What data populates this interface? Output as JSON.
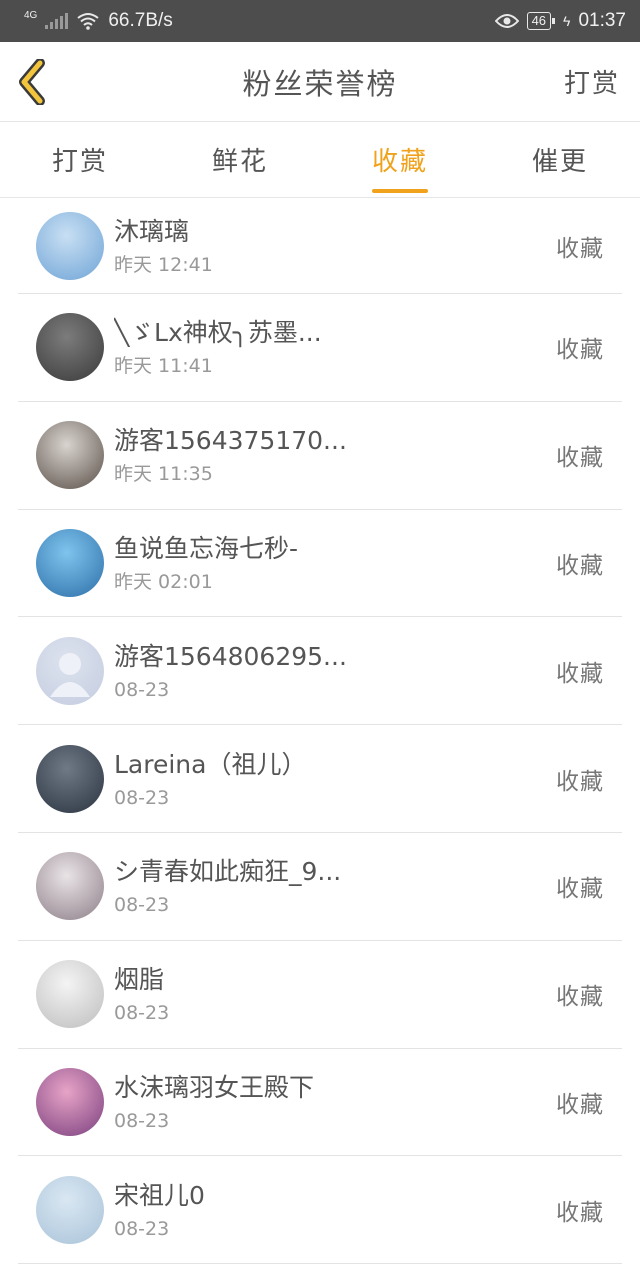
{
  "status_bar": {
    "network_type": "4G",
    "speed": "66.7B/s",
    "battery": "46",
    "time": "01:37"
  },
  "header": {
    "back_icon": "chevron-left-icon",
    "title": "粉丝荣誉榜",
    "action_label": "打赏"
  },
  "tabs": [
    {
      "label": "打赏",
      "active": false
    },
    {
      "label": "鲜花",
      "active": false
    },
    {
      "label": "收藏",
      "active": true
    },
    {
      "label": "催更",
      "active": false
    }
  ],
  "colors": {
    "accent": "#f0a21c",
    "status_bar": "#4d4d4d"
  },
  "fans": [
    {
      "name": "沐璃璃",
      "time": "昨天 12:41",
      "action": "收藏",
      "avatar_colors": [
        "#c8dff3",
        "#6fa4d6"
      ]
    },
    {
      "name": "╲ゞLx神权╮苏墨...",
      "time": "昨天 11:41",
      "action": "收藏",
      "avatar_colors": [
        "#7c7c7c",
        "#3a3a3a"
      ]
    },
    {
      "name": "游客1564375170...",
      "time": "昨天 11:35",
      "action": "收藏",
      "avatar_colors": [
        "#d9d4cf",
        "#5a4f48"
      ]
    },
    {
      "name": "鱼说鱼忘海七秒-",
      "time": "昨天 02:01",
      "action": "收藏",
      "avatar_colors": [
        "#7fc4ee",
        "#2d6fa8"
      ]
    },
    {
      "name": "游客1564806295...",
      "time": "08-23",
      "action": "收藏",
      "avatar_colors": [
        "#dde3ee",
        "#c3cce0"
      ]
    },
    {
      "name": "Lareina（祖儿）",
      "time": "08-23",
      "action": "收藏",
      "avatar_colors": [
        "#6f7a86",
        "#2b3340"
      ]
    },
    {
      "name": "シ青春如此痴狂_9...",
      "time": "08-23",
      "action": "收藏",
      "avatar_colors": [
        "#e9e3e6",
        "#8d7f88"
      ]
    },
    {
      "name": "烟脂",
      "time": "08-23",
      "action": "收藏",
      "avatar_colors": [
        "#f4f4f4",
        "#bdbdbd"
      ]
    },
    {
      "name": "水沫璃羽女王殿下",
      "time": "08-23",
      "action": "收藏",
      "avatar_colors": [
        "#e7a4c7",
        "#7a3f7e"
      ]
    },
    {
      "name": "宋祖儿0",
      "time": "08-23",
      "action": "收藏",
      "avatar_colors": [
        "#d9e7f2",
        "#a9c3d9"
      ]
    }
  ]
}
